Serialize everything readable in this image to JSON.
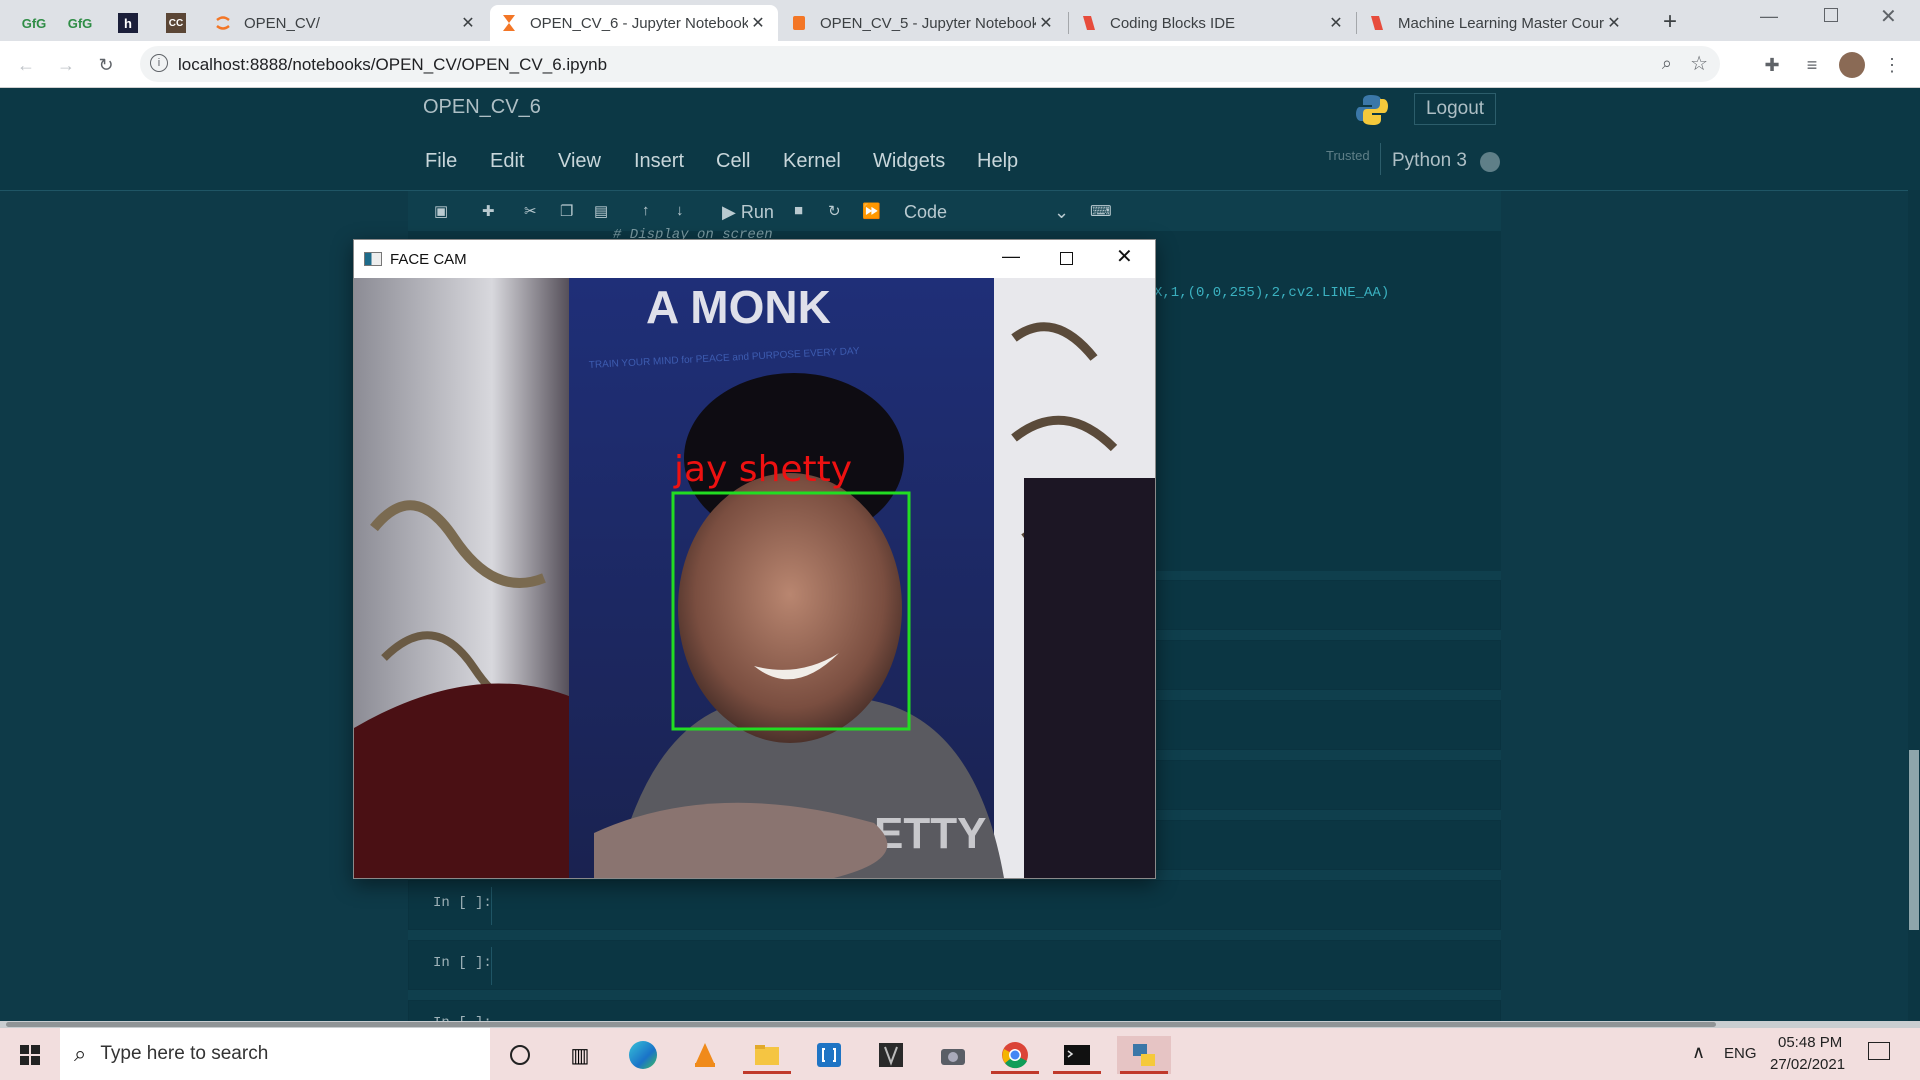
{
  "browser": {
    "tabs": [
      {
        "title": "OPEN_CV/",
        "active": false
      },
      {
        "title": "OPEN_CV_6 - Jupyter Notebook",
        "active": true
      },
      {
        "title": "OPEN_CV_5 - Jupyter Notebook",
        "active": false
      },
      {
        "title": "Coding Blocks IDE",
        "active": false
      },
      {
        "title": "Machine Learning Master Course",
        "active": false
      }
    ],
    "pinned_tabs": [
      "GfG",
      "GfG",
      "h",
      "CC"
    ],
    "new_tab": "+",
    "url": "localhost:8888/notebooks/OPEN_CV/OPEN_CV_6.ipynb"
  },
  "jupyter": {
    "notebook_title": "OPEN_CV_6",
    "logout": "Logout",
    "trusted": "Trusted",
    "kernel": "Python 3",
    "menu": [
      "File",
      "Edit",
      "View",
      "Insert",
      "Cell",
      "Kernel",
      "Widgets",
      "Help"
    ],
    "toolbar": {
      "run": "Run",
      "cell_type": "Code"
    },
    "code_comment": "# Display on screen",
    "code_tail": "X,1,(0,0,255),2,cv2.LINE_AA)",
    "cell_prompts": [
      "In [ ]:",
      "In [ ]:",
      "In [ ]:"
    ]
  },
  "window": {
    "title": "FACE CAM",
    "label": "jay shetty",
    "book_text": "A MONK",
    "book_subtitle": "TRAIN YOUR MIND for PEACE and PURPOSE EVERY DAY",
    "shirt_text": "ETTY",
    "box_color": "#22dd22",
    "label_color": "#ee1111"
  },
  "taskbar": {
    "search_placeholder": "Type here to search",
    "language": "ENG",
    "time": "05:48 PM",
    "date": "27/02/2021"
  },
  "colors": {
    "jupyter_bg": "#0e3a48",
    "tabstrip": "#dee1e6",
    "taskbar": "#f2dede"
  }
}
